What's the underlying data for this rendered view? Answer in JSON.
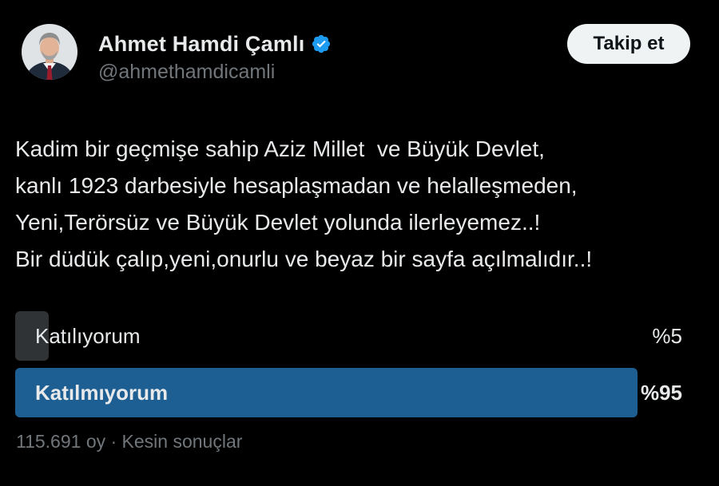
{
  "author": {
    "display_name": "Ahmet Hamdi Çamlı",
    "handle": "@ahmethamdicamli",
    "verified": true,
    "avatar_icon": "profile-photo",
    "verified_color": "#1d9bf0"
  },
  "follow_button": {
    "label": "Takip et"
  },
  "tweet": {
    "lines": [
      "Kadim bir geçmişe sahip Aziz Millet  ve Büyük Devlet,",
      "kanlı 1923 darbesiyle hesaplaşmadan ve helalleşmeden,",
      "Yeni,Terörsüz ve Büyük Devlet yolunda ilerleyemez..!",
      "Bir düdük çalıp,yeni,onurlu ve beyaz bir sayfa açılmalıdır..!"
    ]
  },
  "poll": {
    "options": [
      {
        "label": "Katılıyorum",
        "percent_text": "%5",
        "percent": 5,
        "winner": false
      },
      {
        "label": "Katılmıyorum",
        "percent_text": "%95",
        "percent": 95,
        "winner": true
      }
    ],
    "footer": "115.691 oy · Kesin sonuçlar",
    "winner_color": "#1d5f92",
    "loser_color": "#2f3336"
  }
}
